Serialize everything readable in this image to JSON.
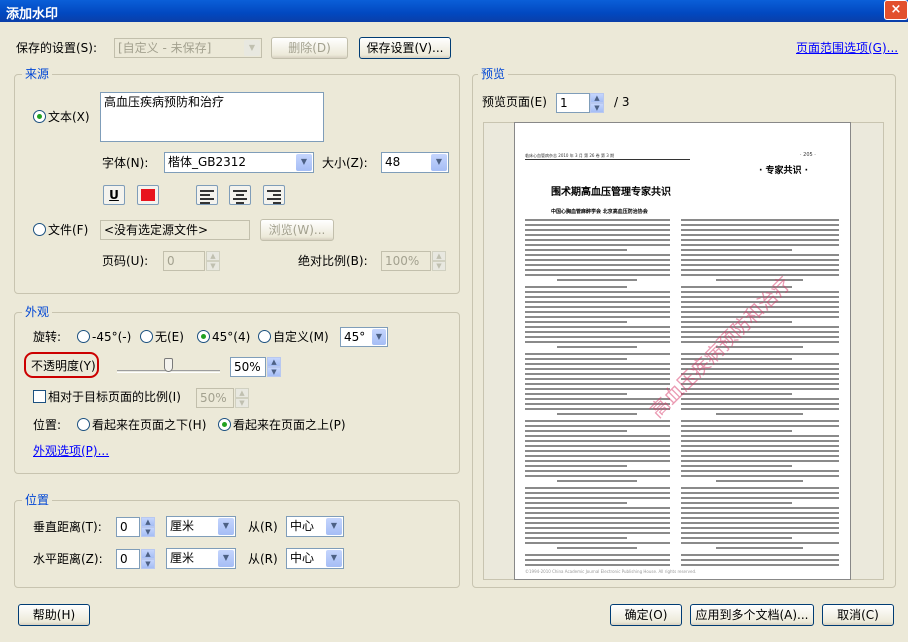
{
  "window": {
    "title": "添加水印",
    "close": "×"
  },
  "saved_settings": {
    "label": "保存的设置(S):",
    "value": "[自定义 - 未保存]",
    "delete_label": "删除(D)",
    "save_label": "保存设置(V)...",
    "page_range_label": "页面范围选项(G)..."
  },
  "source": {
    "title": "来源",
    "text_label": "文本(X)",
    "text_value": "高血压疾病预防和治疗",
    "font_label": "字体(N):",
    "font_value": "楷体_GB2312",
    "size_label": "大小(Z):",
    "size_value": "48",
    "underline_label": "U",
    "file_label": "文件(F)",
    "file_value": "<没有选定源文件>",
    "browse_label": "浏览(W)...",
    "page_label": "页码(U):",
    "page_value": "0",
    "abs_scale_label": "绝对比例(B):",
    "abs_scale_value": "100%"
  },
  "appearance": {
    "title": "外观",
    "rotation_label": "旋转:",
    "rot_neg45": "-45°(-)",
    "rot_none": "无(E)",
    "rot_45": "45°(4)",
    "rot_custom": "自定义(M)",
    "rot_value": "45°",
    "opacity_label": "不透明度(Y)",
    "opacity_value": "50%",
    "opacity_percent": 50,
    "relative_label": "相对于目标页面的比例(I)",
    "relative_value": "50%",
    "position_label": "位置:",
    "pos_behind": "看起来在页面之下(H)",
    "pos_front": "看起来在页面之上(P)",
    "options_link": "外观选项(P)..."
  },
  "location": {
    "title": "位置",
    "vertical_label": "垂直距离(T):",
    "vertical_value": "0",
    "vertical_unit": "厘米",
    "vertical_from_label": "从(R)",
    "vertical_from_value": "中心",
    "horizontal_label": "水平距离(Z):",
    "horizontal_value": "0",
    "horizontal_unit": "厘米",
    "horizontal_from_label": "从(R)",
    "horizontal_from_value": "中心"
  },
  "preview": {
    "title": "预览",
    "page_label": "预览页面(E)",
    "page_value": "1",
    "page_total": "/ 3",
    "doc_header_left": "临床心血管病杂志 2010 年 3 月 第 26 卷 第 3 期",
    "doc_header_right": "· 205 ·",
    "doc_section": "· 专家共识 ·",
    "doc_title": "围术期高血压管理专家共识",
    "doc_authors": "中国心胸血管麻醉学会 北京高血压防治协会",
    "doc_footer": "©1994-2010 China Academic Journal Electronic Publishing House. All rights reserved.",
    "watermark": "高血压疾病预防和治疗"
  },
  "footer": {
    "help": "帮助(H)",
    "ok": "确定(O)",
    "apply_multi": "应用到多个文档(A)...",
    "cancel": "取消(C)"
  },
  "colors": {
    "accent": "#0046d5",
    "watermark": "#d83a6a",
    "highlight_circle": "#cc0000",
    "swatch_red": "#e8141e"
  }
}
